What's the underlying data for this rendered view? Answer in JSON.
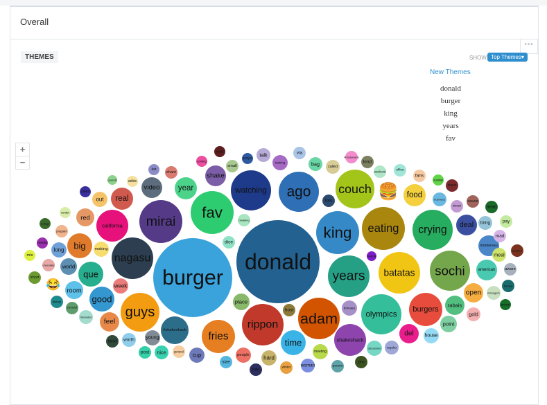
{
  "page": {
    "section_title": "Overall"
  },
  "panel": {
    "tab_label": "THEMES",
    "menu_icon": "more-dots-icon",
    "show_label": "SHOW",
    "show_dropdown": "Top Themes▾",
    "new_themes_heading": "New Themes",
    "new_themes": [
      "donald",
      "burger",
      "king",
      "years",
      "fav"
    ],
    "zoom_in": "+",
    "zoom_out": "−"
  },
  "chart_data": {
    "type": "bubble",
    "title": "THEMES",
    "bubbles": [
      {
        "label": "donald",
        "color": "#236190",
        "size": 100
      },
      {
        "label": "burger",
        "color": "#3aa3dc",
        "size": 95
      },
      {
        "label": "fav",
        "color": "#2ecc71",
        "size": 52
      },
      {
        "label": "mirai",
        "color": "#553a88",
        "size": 52
      },
      {
        "label": "nagasu",
        "color": "#2c3e50",
        "size": 52
      },
      {
        "label": "king",
        "color": "#3589c7",
        "size": 52
      },
      {
        "label": "eating",
        "color": "#a9860e",
        "size": 52
      },
      {
        "label": "crying",
        "color": "#26ad5f",
        "size": 52
      },
      {
        "label": "sochi",
        "color": "#74a64c",
        "size": 52
      },
      {
        "label": "batatas",
        "color": "#f0c514",
        "size": 52
      },
      {
        "label": "years",
        "color": "#25a085",
        "size": 52
      },
      {
        "label": "olympics",
        "color": "#34bf9a",
        "size": 52
      },
      {
        "label": "adam",
        "color": "#d35400",
        "size": 52
      },
      {
        "label": "rippon",
        "color": "#c0392b",
        "size": 52
      },
      {
        "label": "watching",
        "color": "#1e3a8a",
        "size": 52
      },
      {
        "label": "ago",
        "color": "#2f6fb6",
        "size": 52
      },
      {
        "label": "couch",
        "color": "#a3c51a",
        "size": 52
      },
      {
        "label": "guys",
        "color": "#f39c12",
        "size": 52
      },
      {
        "label": "fries",
        "color": "#e67e22",
        "size": 40
      },
      {
        "label": "burgers",
        "color": "#e74c3c",
        "size": 40
      },
      {
        "label": "shakeshack",
        "color": "#8e44ad",
        "size": 40
      },
      {
        "label": "california",
        "color": "#e6117b",
        "size": 40
      },
      {
        "label": "#shakeshack",
        "color": "#2c6e8a",
        "size": 40
      },
      {
        "label": "que",
        "color": "#27ae8f",
        "size": 30
      },
      {
        "label": "big",
        "color": "#e07b2c",
        "size": 30
      },
      {
        "label": "good",
        "color": "#3497d0",
        "size": 30
      },
      {
        "label": "time",
        "color": "#3ab4e6",
        "size": 30
      },
      {
        "label": "real",
        "color": "#d05a4e",
        "size": 26
      },
      {
        "label": "food",
        "color": "#f4d03f",
        "size": 26
      },
      {
        "label": "del",
        "color": "#e91e8c",
        "size": 24
      },
      {
        "label": "deal",
        "color": "#3b4fa0",
        "size": 24
      },
      {
        "label": "shake",
        "color": "#7b5ea7",
        "size": 24
      },
      {
        "label": "video",
        "color": "#5d6d7e",
        "size": 24
      },
      {
        "label": "year",
        "color": "#4cd38a",
        "size": 24
      },
      {
        "label": "feel",
        "color": "#e8894a",
        "size": 24
      },
      {
        "label": "red",
        "color": "#e59866",
        "size": 22
      },
      {
        "label": "rabais",
        "color": "#52be80",
        "size": 22
      },
      {
        "label": "open",
        "color": "#f5ad42",
        "size": 20
      },
      {
        "label": "point",
        "color": "#7dcea0",
        "size": 20
      },
      {
        "label": "montereau",
        "color": "#4a86c8",
        "size": 22
      },
      {
        "label": "american",
        "color": "#48c9b0",
        "size": 22
      },
      {
        "label": "room",
        "color": "#5dc1ea",
        "size": 22
      },
      {
        "label": "world",
        "color": "#5d8fb3",
        "size": 20
      },
      {
        "label": "long",
        "color": "#6fa0d8",
        "size": 18
      },
      {
        "label": "out",
        "color": "#f5c46a",
        "size": 18
      },
      {
        "label": "place",
        "color": "#88b86a",
        "size": 18
      },
      {
        "label": "host",
        "color": "#8c7a3a",
        "size": 14
      },
      {
        "label": "meeting",
        "color": "#b8d94a",
        "size": 18
      },
      {
        "label": "hard",
        "color": "#c8b36a",
        "size": 18
      },
      {
        "label": "people",
        "color": "#ec7063",
        "size": 18
      },
      {
        "label": "discussion",
        "color": "#76d7c4",
        "size": 16
      },
      {
        "label": "regular",
        "color": "#9ea7d6",
        "size": 14
      },
      {
        "label": "pro",
        "color": "#3b5320",
        "size": 14
      },
      {
        "label": "person",
        "color": "#5fa3a8",
        "size": 14
      },
      {
        "label": "woman",
        "color": "#7b8fde",
        "size": 14
      },
      {
        "label": "winter",
        "color": "#e8a040",
        "size": 14
      },
      {
        "label": "foto",
        "color": "#2c2f5e",
        "size": 14
      },
      {
        "label": "size",
        "color": "#55b6e0",
        "size": 14
      },
      {
        "label": "cup",
        "color": "#6d79b8",
        "size": 16
      },
      {
        "label": "general",
        "color": "#f5cda0",
        "size": 14
      },
      {
        "label": "nice",
        "color": "#3ad1b0",
        "size": 14
      },
      {
        "label": "post",
        "color": "#35cfa8",
        "size": 14
      },
      {
        "label": "young",
        "color": "#808b96",
        "size": 16
      },
      {
        "label": "worth",
        "color": "#8fcdea",
        "size": 16
      },
      {
        "label": "land",
        "color": "#2f4a3a",
        "size": 14
      },
      {
        "label": "february",
        "color": "#a690c8",
        "size": 16
      },
      {
        "label": "house",
        "color": "#95daf5",
        "size": 16
      },
      {
        "label": "gold",
        "color": "#f4b0b0",
        "size": 14
      },
      {
        "label": "week",
        "color": "#ec7b7b",
        "size": 16
      },
      {
        "label": "making",
        "color": "#f7dc6f",
        "size": 16
      },
      {
        "label": "dice",
        "color": "#8ee0c6",
        "size": 12
      },
      {
        "label": "breaking",
        "color": "#a8e6c0",
        "size": 12
      },
      {
        "label": "lots",
        "color": "#2c4a6e",
        "size": 12
      },
      {
        "label": "handa",
        "color": "#7d1ec8",
        "size": 10
      },
      {
        "label": "talk",
        "color": "#b6aad6",
        "size": 12
      },
      {
        "label": "via",
        "color": "#a8c4e6",
        "size": 12
      },
      {
        "label": "bag",
        "color": "#6ad6a6",
        "size": 13
      },
      {
        "label": "called",
        "color": "#d8cc96",
        "size": 12
      },
      {
        "label": "kind",
        "color": "#7d8060",
        "size": 12
      },
      {
        "label": "#mcdonalds",
        "color": "#f28ccc",
        "size": 11
      },
      {
        "label": "weekend",
        "color": "#b0e6c8",
        "size": 11
      },
      {
        "label": "office",
        "color": "#a0e6d8",
        "size": 11
      },
      {
        "label": "fans",
        "color": "#f5c8a0",
        "size": 11
      },
      {
        "label": "sunday",
        "color": "#62d44a",
        "size": 10
      },
      {
        "label": "stupid",
        "color": "#7a2c2c",
        "size": 10
      },
      {
        "label": "business",
        "color": "#6ab8e0",
        "size": 12
      },
      {
        "label": "street",
        "color": "#c39bd3",
        "size": 11
      },
      {
        "label": "sauce",
        "color": "#a0645a",
        "size": 10
      },
      {
        "label": "head",
        "color": "#1a6b2a",
        "size": 10
      },
      {
        "label": "bring",
        "color": "#94c4d8",
        "size": 12
      },
      {
        "label": "pay",
        "color": "#c4eaa0",
        "size": 11
      },
      {
        "label": "road",
        "color": "#d7b4e8",
        "size": 11
      },
      {
        "label": "meal",
        "color": "#cde36a",
        "size": 12
      },
      {
        "label": "location",
        "color": "#78321e",
        "size": 10
      },
      {
        "label": "aware",
        "color": "#a7b1bd",
        "size": 11
      },
      {
        "label": "literally",
        "color": "#1a6b6e",
        "size": 11
      },
      {
        "label": "managers",
        "color": "#c8e0c0",
        "size": 11
      },
      {
        "label": "animal",
        "color": "#176e2a",
        "size": 10
      },
      {
        "label": "pays",
        "color": "#2f5aa0",
        "size": 10
      },
      {
        "label": "small",
        "color": "#a8c890",
        "size": 11
      },
      {
        "label": "credit",
        "color": "#5c1e1e",
        "size": 10
      },
      {
        "label": "coming",
        "color": "#ec4fa0",
        "size": 10
      },
      {
        "label": "training",
        "color": "#a56ac4",
        "size": 12
      },
      {
        "label": "list",
        "color": "#8c8cc8",
        "size": 10
      },
      {
        "label": "share",
        "color": "#d97a70",
        "size": 11
      },
      {
        "label": "adiós",
        "color": "#f5e0a0",
        "size": 10
      },
      {
        "label": "pounds",
        "color": "#8cd18c",
        "size": 10
      },
      {
        "label": "sales",
        "color": "#3a2f9e",
        "size": 10
      },
      {
        "label": "center",
        "color": "#d8eca8",
        "size": 11
      },
      {
        "label": "program",
        "color": "#f2b48c",
        "size": 11
      },
      {
        "label": "college",
        "color": "#3a6a2a",
        "size": 10
      },
      {
        "label": "media",
        "color": "#9b2fae",
        "size": 10
      },
      {
        "label": "mis",
        "color": "#dcf040",
        "size": 10
      },
      {
        "label": "chocolate",
        "color": "#e8a8a8",
        "size": 11
      },
      {
        "label": "short",
        "color": "#6b9a30",
        "size": 11
      },
      {
        "label": "😂",
        "color": "#ffffff",
        "size": 11
      },
      {
        "label": "history",
        "color": "#1f8a8e",
        "size": 11
      },
      {
        "label": "record",
        "color": "#5e9c6e",
        "size": 11
      },
      {
        "label": "traînados",
        "color": "#a3dccc",
        "size": 11
      },
      {
        "label": "🍔",
        "color": "#ffffff",
        "size": 14
      }
    ]
  }
}
